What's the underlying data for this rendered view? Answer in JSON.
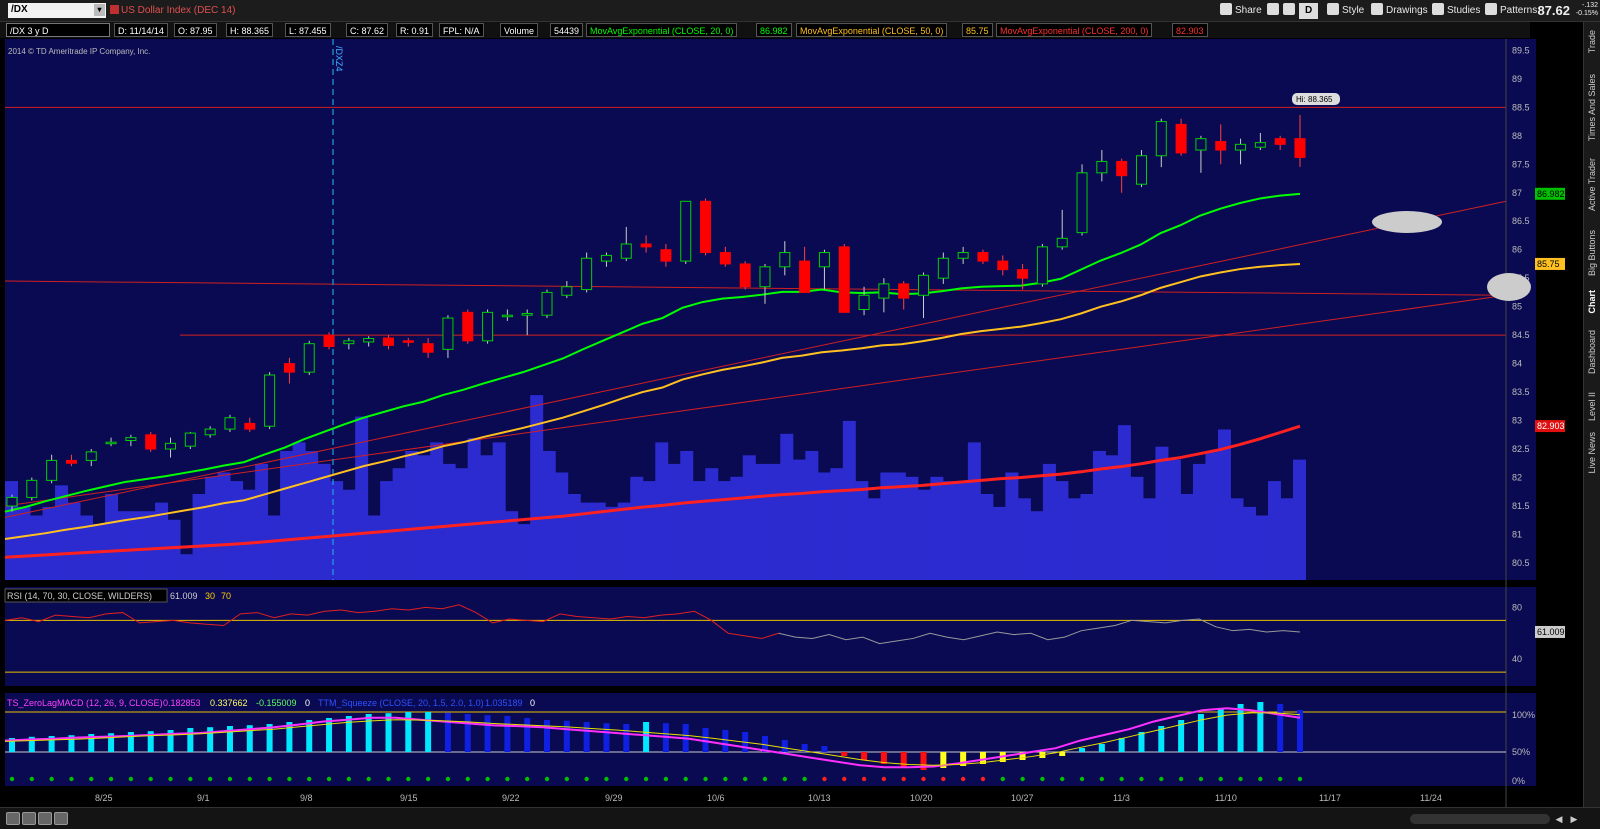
{
  "toolbar": {
    "symbol": "/DX",
    "symbol_desc": "US Dollar Index (DEC 14)",
    "share_label": "Share",
    "style_label": "Style",
    "drawings_label": "Drawings",
    "studies_label": "Studies",
    "patterns_label": "Patterns",
    "d_label": "D",
    "last_price": "87.62",
    "change_top": "-.132",
    "change_bottom": "-0.15%"
  },
  "info": {
    "period": "/DX 3 y D",
    "date": "D: 11/14/14",
    "open": "O: 87.95",
    "high": "H: 88.365",
    "low": "L: 87.455",
    "close": "C: 87.62",
    "range": "R: 0.91",
    "fpl": "FPL: N/A",
    "volume_label": "Volume",
    "volume_value": "54439",
    "ema20_label": "MovAvgExponential (CLOSE, 20, 0)",
    "ema20_value": "86.982",
    "ema50_label": "MovAvgExponential (CLOSE, 50, 0)",
    "ema50_value": "85.75",
    "ema200_label": "MovAvgExponential (CLOSE, 200, 0)",
    "ema200_value": "82.903",
    "copyright": "2014 © TD Ameritrade IP Company, Inc.",
    "contract_marker": "/DXZ4",
    "hi_label": "Hi: 88.365"
  },
  "rsi": {
    "label": "RSI (14, 70, 30, CLOSE, WILDERS)",
    "value": "61.009",
    "low": "30",
    "high": "70",
    "axis": [
      "80",
      "40"
    ],
    "current_tag": "61.009"
  },
  "macd": {
    "label": "TS_ZeroLagMACD (12, 26, 9, CLOSE)",
    "v1": "0.182853",
    "v2": "0.337662",
    "v3": "-0.155009",
    "v4": "0",
    "squeeze_label": "TTM_Squeeze (CLOSE, 20, 1.5, 2.0, 1.0)",
    "squeeze_v1": "1.035189",
    "squeeze_v2": "0",
    "axis": [
      "100%",
      "50%",
      "0%"
    ]
  },
  "right_tabs": [
    "Trade",
    "Times And Sales",
    "Active Trader",
    "Big Buttons",
    "Chart",
    "Dashboard",
    "Level II",
    "Live News"
  ],
  "colors": {
    "background": "#0a0a52",
    "up": "#00c000",
    "down": "#ff0000",
    "ema20": "#00ff00",
    "ema50": "#ffc020",
    "ema200": "#ff2020",
    "volume": "#2b2bd0"
  },
  "chart_data": [
    {
      "type": "candlestick",
      "title": "US Dollar Index (DEC 14)",
      "x_ticks": [
        "8/25",
        "9/1",
        "9/8",
        "9/15",
        "9/22",
        "9/29",
        "10/6",
        "10/13",
        "10/20",
        "10/27",
        "11/3",
        "11/10",
        "11/17",
        "11/24"
      ],
      "y_ticks": [
        "89.5",
        "89",
        "88.5",
        "88",
        "87.5",
        "87",
        "86.5",
        "86",
        "85.5",
        "85",
        "84.5",
        "84",
        "83.5",
        "83",
        "82.5",
        "82",
        "81.5",
        "81",
        "80.5"
      ],
      "ylim": [
        80.2,
        89.7
      ],
      "candles": [
        {
          "o": 81.5,
          "h": 81.7,
          "l": 81.4,
          "c": 81.65
        },
        {
          "o": 81.65,
          "h": 82.0,
          "l": 81.6,
          "c": 81.95
        },
        {
          "o": 81.95,
          "h": 82.4,
          "l": 81.9,
          "c": 82.3
        },
        {
          "o": 82.3,
          "h": 82.4,
          "l": 82.2,
          "c": 82.25
        },
        {
          "o": 82.3,
          "h": 82.5,
          "l": 82.2,
          "c": 82.45
        },
        {
          "o": 82.6,
          "h": 82.7,
          "l": 82.55,
          "c": 82.62
        },
        {
          "o": 82.65,
          "h": 82.75,
          "l": 82.55,
          "c": 82.7
        },
        {
          "o": 82.75,
          "h": 82.8,
          "l": 82.45,
          "c": 82.5
        },
        {
          "o": 82.5,
          "h": 82.7,
          "l": 82.35,
          "c": 82.6
        },
        {
          "o": 82.55,
          "h": 82.8,
          "l": 82.5,
          "c": 82.78
        },
        {
          "o": 82.75,
          "h": 82.9,
          "l": 82.7,
          "c": 82.85
        },
        {
          "o": 82.85,
          "h": 83.1,
          "l": 82.8,
          "c": 83.05
        },
        {
          "o": 82.95,
          "h": 83.05,
          "l": 82.8,
          "c": 82.85
        },
        {
          "o": 82.9,
          "h": 83.85,
          "l": 82.85,
          "c": 83.8
        },
        {
          "o": 84.0,
          "h": 84.1,
          "l": 83.65,
          "c": 83.85
        },
        {
          "o": 83.85,
          "h": 84.4,
          "l": 83.8,
          "c": 84.35
        },
        {
          "o": 84.5,
          "h": 84.55,
          "l": 84.25,
          "c": 84.3
        },
        {
          "o": 84.35,
          "h": 84.45,
          "l": 84.25,
          "c": 84.4
        },
        {
          "o": 84.38,
          "h": 84.48,
          "l": 84.3,
          "c": 84.44
        },
        {
          "o": 84.45,
          "h": 84.5,
          "l": 84.25,
          "c": 84.32
        },
        {
          "o": 84.4,
          "h": 84.45,
          "l": 84.3,
          "c": 84.38
        },
        {
          "o": 84.35,
          "h": 84.45,
          "l": 84.1,
          "c": 84.2
        },
        {
          "o": 84.25,
          "h": 84.85,
          "l": 84.1,
          "c": 84.8
        },
        {
          "o": 84.9,
          "h": 84.95,
          "l": 84.35,
          "c": 84.4
        },
        {
          "o": 84.4,
          "h": 84.95,
          "l": 84.35,
          "c": 84.9
        },
        {
          "o": 84.85,
          "h": 84.95,
          "l": 84.75,
          "c": 84.85
        },
        {
          "o": 84.85,
          "h": 84.95,
          "l": 84.5,
          "c": 84.88
        },
        {
          "o": 84.85,
          "h": 85.3,
          "l": 84.8,
          "c": 85.25
        },
        {
          "o": 85.2,
          "h": 85.45,
          "l": 85.15,
          "c": 85.35
        },
        {
          "o": 85.3,
          "h": 85.95,
          "l": 85.25,
          "c": 85.85
        },
        {
          "o": 85.8,
          "h": 85.95,
          "l": 85.7,
          "c": 85.9
        },
        {
          "o": 85.85,
          "h": 86.4,
          "l": 85.8,
          "c": 86.1
        },
        {
          "o": 86.1,
          "h": 86.25,
          "l": 85.95,
          "c": 86.05
        },
        {
          "o": 86.0,
          "h": 86.1,
          "l": 85.7,
          "c": 85.8
        },
        {
          "o": 85.8,
          "h": 86.85,
          "l": 85.75,
          "c": 86.85
        },
        {
          "o": 86.85,
          "h": 86.9,
          "l": 85.9,
          "c": 85.95
        },
        {
          "o": 85.95,
          "h": 86.05,
          "l": 85.7,
          "c": 85.75
        },
        {
          "o": 85.75,
          "h": 85.8,
          "l": 85.3,
          "c": 85.35
        },
        {
          "o": 85.35,
          "h": 85.75,
          "l": 85.05,
          "c": 85.7
        },
        {
          "o": 85.7,
          "h": 86.15,
          "l": 85.55,
          "c": 85.95
        },
        {
          "o": 85.8,
          "h": 86.05,
          "l": 85.25,
          "c": 85.25
        },
        {
          "o": 85.7,
          "h": 86.0,
          "l": 85.3,
          "c": 85.95
        },
        {
          "o": 86.05,
          "h": 86.1,
          "l": 84.9,
          "c": 84.9
        },
        {
          "o": 84.95,
          "h": 85.35,
          "l": 84.85,
          "c": 85.2
        },
        {
          "o": 85.15,
          "h": 85.5,
          "l": 84.9,
          "c": 85.4
        },
        {
          "o": 85.4,
          "h": 85.45,
          "l": 84.95,
          "c": 85.15
        },
        {
          "o": 85.2,
          "h": 85.6,
          "l": 84.8,
          "c": 85.55
        },
        {
          "o": 85.5,
          "h": 85.95,
          "l": 85.4,
          "c": 85.85
        },
        {
          "o": 85.85,
          "h": 86.05,
          "l": 85.75,
          "c": 85.95
        },
        {
          "o": 85.95,
          "h": 86.0,
          "l": 85.75,
          "c": 85.8
        },
        {
          "o": 85.8,
          "h": 85.9,
          "l": 85.55,
          "c": 85.65
        },
        {
          "o": 85.65,
          "h": 85.75,
          "l": 85.3,
          "c": 85.5
        },
        {
          "o": 85.4,
          "h": 86.1,
          "l": 85.35,
          "c": 86.05
        },
        {
          "o": 86.05,
          "h": 86.7,
          "l": 86.0,
          "c": 86.2
        },
        {
          "o": 86.3,
          "h": 87.5,
          "l": 86.25,
          "c": 87.35
        },
        {
          "o": 87.35,
          "h": 87.75,
          "l": 87.2,
          "c": 87.55
        },
        {
          "o": 87.55,
          "h": 87.6,
          "l": 87.0,
          "c": 87.3
        },
        {
          "o": 87.15,
          "h": 87.75,
          "l": 87.1,
          "c": 87.65
        },
        {
          "o": 87.65,
          "h": 88.3,
          "l": 87.45,
          "c": 88.25
        },
        {
          "o": 88.2,
          "h": 88.3,
          "l": 87.65,
          "c": 87.7
        },
        {
          "o": 87.75,
          "h": 88.0,
          "l": 87.35,
          "c": 87.95
        },
        {
          "o": 87.9,
          "h": 88.2,
          "l": 87.5,
          "c": 87.75
        },
        {
          "o": 87.75,
          "h": 87.95,
          "l": 87.5,
          "c": 87.85
        },
        {
          "o": 87.8,
          "h": 88.05,
          "l": 87.75,
          "c": 87.88
        },
        {
          "o": 87.95,
          "h": 88.0,
          "l": 87.75,
          "c": 87.85
        },
        {
          "o": 87.95,
          "h": 88.365,
          "l": 87.455,
          "c": 87.62
        }
      ],
      "volume": [
        230,
        170,
        150,
        170,
        220,
        180,
        150,
        130,
        200,
        160,
        160,
        160,
        180,
        140,
        60,
        200,
        240,
        250,
        230,
        210,
        270,
        150,
        300,
        320,
        300,
        270,
        230,
        210,
        380,
        150,
        230,
        260,
        300,
        290,
        320,
        270,
        260,
        330,
        290,
        320,
        160,
        130,
        430,
        300,
        250,
        200,
        180,
        180,
        170,
        180,
        240,
        230,
        320,
        270,
        300,
        230,
        260,
        230,
        240,
        290,
        270,
        270,
        340,
        280,
        300,
        250,
        260,
        370,
        230,
        190,
        250,
        250,
        240,
        210,
        240,
        230,
        230,
        320,
        200,
        170,
        250,
        190,
        160,
        270,
        230,
        190,
        200,
        300,
        290,
        360,
        240,
        190,
        310,
        280,
        200,
        270,
        300,
        350,
        190,
        170,
        150,
        230,
        190,
        280
      ],
      "series": [
        {
          "name": "MovAvgExponential (CLOSE, 20, 0)",
          "values": [
            81.4,
            81.48,
            81.58,
            81.67,
            81.76,
            81.84,
            81.92,
            81.97,
            82.02,
            82.08,
            82.14,
            82.21,
            82.27,
            82.4,
            82.52,
            82.67,
            82.8,
            82.93,
            83.05,
            83.15,
            83.25,
            83.33,
            83.45,
            83.54,
            83.65,
            83.75,
            83.85,
            83.97,
            84.09,
            84.25,
            84.4,
            84.55,
            84.7,
            84.8,
            84.98,
            85.08,
            85.14,
            85.17,
            85.21,
            85.26,
            85.26,
            85.3,
            85.25,
            85.24,
            85.25,
            85.22,
            85.23,
            85.27,
            85.32,
            85.35,
            85.36,
            85.37,
            85.42,
            85.49,
            85.65,
            85.81,
            85.94,
            86.09,
            86.29,
            86.43,
            86.6,
            86.72,
            86.82,
            86.9,
            86.95,
            86.98
          ]
        },
        {
          "name": "MovAvgExponential (CLOSE, 50, 0)",
          "values": [
            80.92,
            80.97,
            81.02,
            81.08,
            81.13,
            81.19,
            81.25,
            81.3,
            81.36,
            81.42,
            81.48,
            81.55,
            81.6,
            81.7,
            81.8,
            81.9,
            82.0,
            82.1,
            82.2,
            82.28,
            82.37,
            82.45,
            82.55,
            82.62,
            82.71,
            82.79,
            82.87,
            82.96,
            83.05,
            83.16,
            83.27,
            83.39,
            83.5,
            83.58,
            83.72,
            83.81,
            83.89,
            83.95,
            84.02,
            84.1,
            84.14,
            84.2,
            84.23,
            84.27,
            84.32,
            84.34,
            84.39,
            84.45,
            84.52,
            84.57,
            84.61,
            84.65,
            84.71,
            84.78,
            84.88,
            85.0,
            85.09,
            85.2,
            85.33,
            85.43,
            85.53,
            85.6,
            85.66,
            85.7,
            85.73,
            85.75
          ]
        },
        {
          "name": "MovAvgExponential (CLOSE, 200, 0)",
          "values": [
            80.6,
            80.62,
            80.64,
            80.66,
            80.68,
            80.7,
            80.72,
            80.74,
            80.76,
            80.78,
            80.8,
            80.82,
            80.84,
            80.87,
            80.9,
            80.93,
            80.96,
            80.99,
            81.02,
            81.05,
            81.08,
            81.11,
            81.14,
            81.17,
            81.2,
            81.23,
            81.26,
            81.29,
            81.32,
            81.36,
            81.4,
            81.44,
            81.48,
            81.51,
            81.55,
            81.58,
            81.61,
            81.64,
            81.67,
            81.7,
            81.72,
            81.75,
            81.77,
            81.79,
            81.82,
            81.84,
            81.86,
            81.89,
            81.92,
            81.95,
            81.98,
            82.0,
            82.03,
            82.06,
            82.1,
            82.15,
            82.19,
            82.24,
            82.3,
            82.35,
            82.42,
            82.49,
            82.58,
            82.68,
            82.79,
            82.9
          ]
        }
      ]
    },
    {
      "type": "line",
      "title": "RSI (14, 70, 30, CLOSE, WILDERS)",
      "ylim": [
        20,
        95
      ],
      "values": [
        70,
        72,
        69,
        74,
        73,
        72,
        75,
        76,
        68,
        69,
        70,
        68,
        67,
        66,
        75,
        76,
        72,
        75,
        74,
        77,
        78,
        76,
        77,
        79,
        78,
        80,
        79,
        82,
        76,
        68,
        71,
        70,
        69,
        75,
        73,
        72,
        71,
        73,
        72,
        74,
        75,
        77,
        70,
        60,
        58,
        56,
        60,
        57,
        56,
        59,
        55,
        57,
        52,
        54,
        56,
        60,
        57,
        55,
        58,
        61,
        59,
        60,
        55,
        57,
        62,
        64,
        66,
        70,
        69,
        68,
        70,
        71,
        65,
        62,
        63,
        61,
        62,
        61
      ]
    },
    {
      "type": "bar",
      "title": "TS_ZeroLagMACD (12, 26, 9, CLOSE)",
      "squeeze_values": [
        0.35,
        0.38,
        0.4,
        0.42,
        0.45,
        0.47,
        0.5,
        0.52,
        0.55,
        0.6,
        0.62,
        0.65,
        0.67,
        0.7,
        0.75,
        0.8,
        0.85,
        0.9,
        0.95,
        0.97,
        1.0,
        1.0,
        0.98,
        0.95,
        0.92,
        0.9,
        0.85,
        0.8,
        0.78,
        0.75,
        0.72,
        0.7,
        0.75,
        0.72,
        0.7,
        0.6,
        0.55,
        0.5,
        0.4,
        0.3,
        0.2,
        0.15,
        -0.1,
        -0.2,
        -0.3,
        -0.4,
        -0.45,
        -0.4,
        -0.35,
        -0.3,
        -0.25,
        -0.2,
        -0.15,
        -0.1,
        0.1,
        0.2,
        0.35,
        0.5,
        0.65,
        0.8,
        0.95,
        1.1,
        1.2,
        1.25,
        1.2,
        1.05
      ],
      "macd_line": [
        0.3,
        0.33,
        0.35,
        0.38,
        0.4,
        0.42,
        0.45,
        0.48,
        0.5,
        0.55,
        0.6,
        0.65,
        0.72,
        0.8,
        0.85,
        0.9,
        0.9,
        0.85,
        0.8,
        0.75,
        0.7,
        0.68,
        0.65,
        0.6,
        0.55,
        0.5,
        0.45,
        0.4,
        0.35,
        0.25,
        0.15,
        0.05,
        -0.05,
        -0.15,
        -0.25,
        -0.35,
        -0.4,
        -0.4,
        -0.38,
        -0.3,
        -0.2,
        -0.1,
        0.0,
        0.1,
        0.3,
        0.45,
        0.6,
        0.8,
        0.95,
        1.1,
        1.15,
        1.1,
        1.0,
        0.9
      ],
      "signal_line": [
        0.28,
        0.3,
        0.32,
        0.34,
        0.37,
        0.4,
        0.43,
        0.45,
        0.48,
        0.52,
        0.56,
        0.6,
        0.66,
        0.72,
        0.78,
        0.82,
        0.85,
        0.84,
        0.82,
        0.79,
        0.75,
        0.72,
        0.69,
        0.66,
        0.62,
        0.58,
        0.53,
        0.48,
        0.43,
        0.36,
        0.28,
        0.2,
        0.1,
        0.0,
        -0.1,
        -0.2,
        -0.28,
        -0.33,
        -0.35,
        -0.33,
        -0.28,
        -0.2,
        -0.12,
        -0.02,
        0.12,
        0.25,
        0.4,
        0.55,
        0.7,
        0.85,
        0.97,
        1.03,
        1.03,
        0.98
      ]
    }
  ]
}
